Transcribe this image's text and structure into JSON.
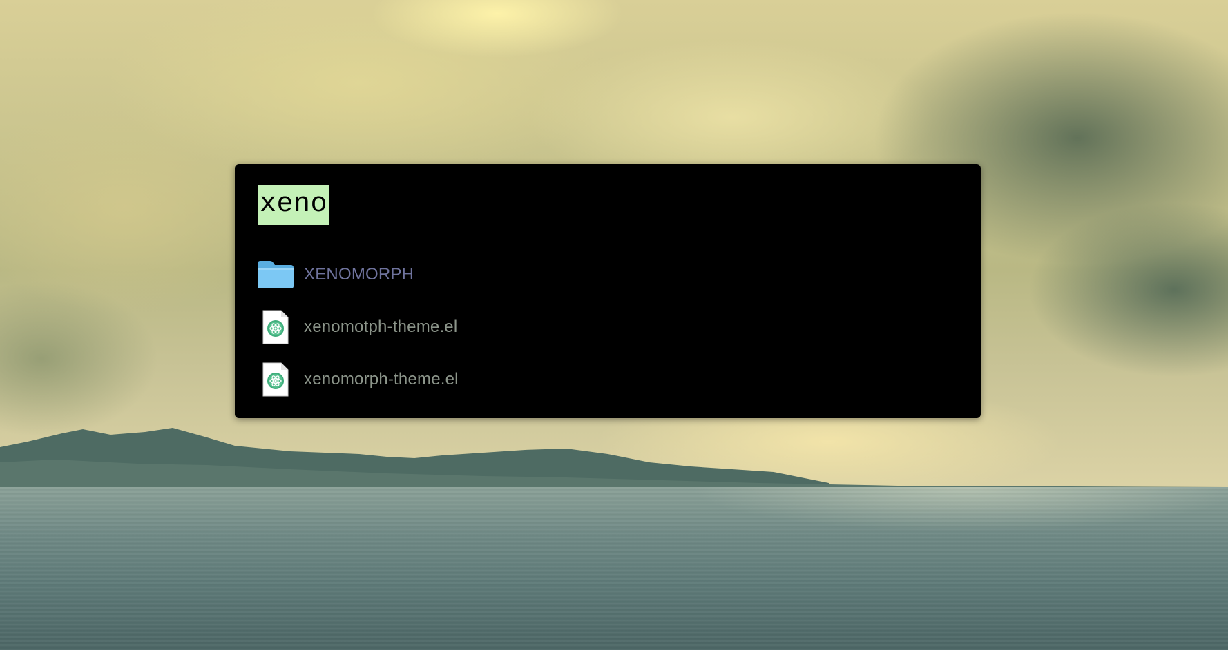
{
  "launcher": {
    "query": "xeno",
    "results": [
      {
        "label": "XENOMORPH",
        "icon": "folder-icon",
        "kind": "folder"
      },
      {
        "label": "xenomotph-theme.el",
        "icon": "emacs-file-icon",
        "kind": "file"
      },
      {
        "label": "xenomorph-theme.el",
        "icon": "emacs-file-icon",
        "kind": "file"
      }
    ]
  },
  "colors": {
    "panel": "#000000",
    "query_highlight": "#c4f1b7",
    "folder_text": "#6f739d",
    "file_text": "#8c958a",
    "folder_icon": "#6fc0f0"
  }
}
